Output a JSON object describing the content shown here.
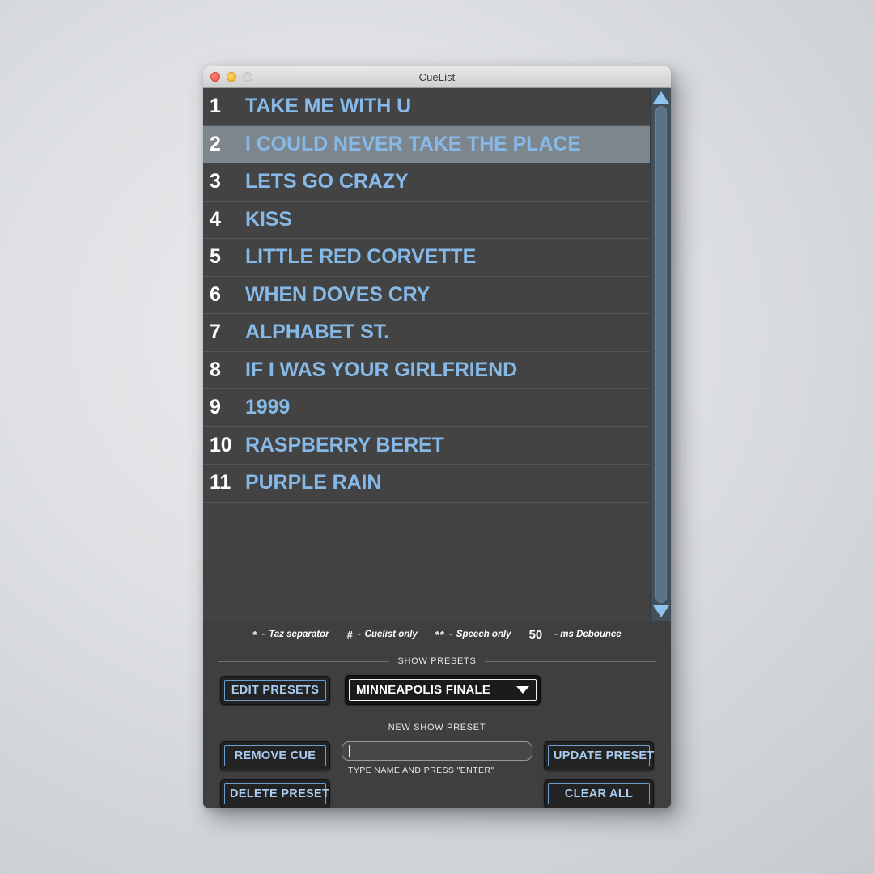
{
  "window": {
    "title": "CueList",
    "controls": {
      "close": "close-button",
      "minimize": "minimize-button",
      "zoom": "zoom-button"
    }
  },
  "cue_list": {
    "selected_index": 2,
    "rows": [
      {
        "num": "1",
        "title": "TAKE ME WITH U"
      },
      {
        "num": "2",
        "title": "I COULD NEVER TAKE THE PLACE"
      },
      {
        "num": "3",
        "title": "LETS GO CRAZY"
      },
      {
        "num": "4",
        "title": "KISS"
      },
      {
        "num": "5",
        "title": "LITTLE RED CORVETTE"
      },
      {
        "num": "6",
        "title": "WHEN DOVES CRY"
      },
      {
        "num": "7",
        "title": "ALPHABET ST."
      },
      {
        "num": "8",
        "title": "IF I WAS YOUR GIRLFRIEND"
      },
      {
        "num": "9",
        "title": "1999"
      },
      {
        "num": "10",
        "title": "RASPBERRY BERET"
      },
      {
        "num": "11",
        "title": "PURPLE RAIN"
      }
    ]
  },
  "scrollbar": {
    "up_arrow": "scroll-up-arrow",
    "down_arrow": "scroll-down-arrow"
  },
  "legend": {
    "items": [
      {
        "symbol": "*",
        "dash": "-",
        "text": "Taz separator"
      },
      {
        "symbol": "#",
        "dash": "-",
        "text": "Cuelist only"
      },
      {
        "symbol": "**",
        "dash": "-",
        "text": "Speech only"
      }
    ],
    "debounce_value": "50",
    "debounce_label": "- ms Debounce"
  },
  "show_presets": {
    "group_label": "SHOW PRESETS",
    "edit_button": "EDIT PRESETS",
    "preset_selected": "MINNEAPOLIS FINALE"
  },
  "new_show_preset": {
    "group_label": "NEW SHOW PRESET",
    "remove_cue_button": "REMOVE CUE",
    "delete_preset_button": "DELETE PRESET",
    "update_preset_button": "UPDATE PRESET",
    "clear_all_button": "CLEAR ALL",
    "name_input_value": "",
    "name_input_placeholder": "",
    "name_input_hint": "TYPE NAME AND PRESS \"ENTER\""
  },
  "colors": {
    "accent_blue": "#86b9e8",
    "button_border_blue": "#6d9fd0",
    "row_bg": "#434343",
    "row_selected_bg": "#7e868d",
    "panel_bg": "#3f3f3f",
    "scrollbar_bg": "#41505a"
  }
}
